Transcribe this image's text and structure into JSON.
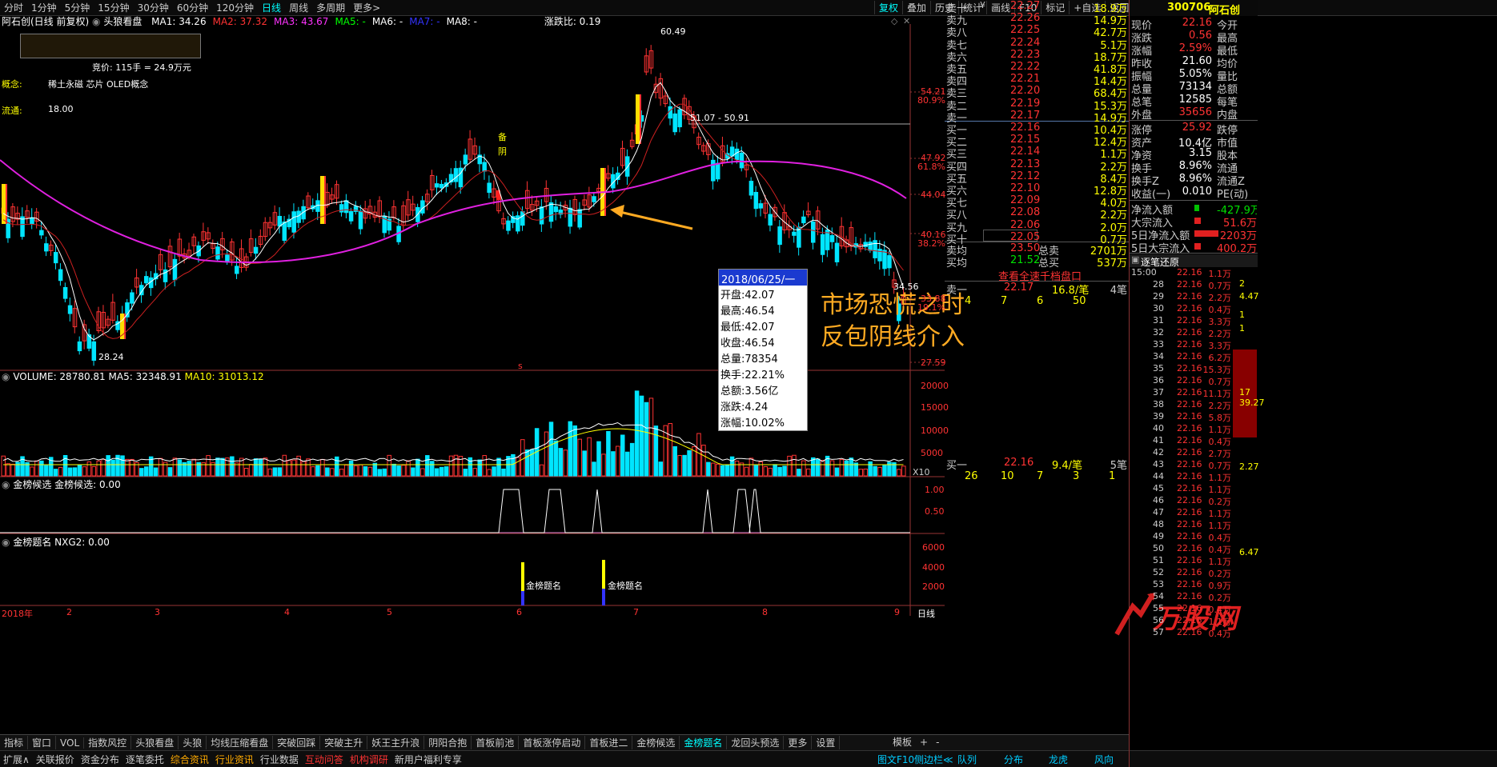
{
  "toolbar": {
    "periods": [
      "分时",
      "1分钟",
      "5分钟",
      "15分钟",
      "30分钟",
      "60分钟",
      "120分钟",
      "日线",
      "周线",
      "多周期",
      "更多>"
    ],
    "active": "日线",
    "tools": [
      "复权",
      "叠加",
      "历史",
      "统计",
      "画线",
      "F10",
      "标记",
      "+自选",
      "返回"
    ]
  },
  "chart": {
    "title": "阿石创(日线 前复权)",
    "indicator": "头狼看盘",
    "ma": [
      {
        "label": "MA1: 34.26",
        "color": "#ffffff"
      },
      {
        "label": "MA2: 37.32",
        "color": "#ff3333"
      },
      {
        "label": "MA3: 43.67",
        "color": "#ff33ff"
      },
      {
        "label": "MA5: -",
        "color": "#00ff00"
      },
      {
        "label": "MA6: -",
        "color": "#ffffff"
      },
      {
        "label": "MA7: -",
        "color": "#3333ff"
      },
      {
        "label": "MA8: -",
        "color": "#ffffff"
      }
    ],
    "ratio": "涨跌比: 0.19",
    "bid": "竞价: 115手 = 24.9万元",
    "concept_label": "概念:",
    "concept": "稀土永磁 芯片 OLED概念",
    "float_label": "流通:",
    "float_value": "18.00",
    "price_axis": [
      {
        "v": "54.21",
        "p": "80.9%"
      },
      {
        "v": "47.92",
        "p": "61.8%"
      },
      {
        "v": "44.04",
        "p": ""
      },
      {
        "v": "40.16",
        "p": "38.2%"
      },
      {
        "v": "33.88",
        "p": "19.1%"
      },
      {
        "v": "27.59",
        "p": ""
      }
    ],
    "high_label": "60.49",
    "low_label": "28.24",
    "range_label": "51.07 - 50.91",
    "last_label": "34.56",
    "mark_text1": "备",
    "mark_text2": "阴",
    "s_marker": "s"
  },
  "tooltip": {
    "date": "2018/06/25/一",
    "lines": [
      "开盘:42.07",
      "最高:46.54",
      "最低:42.07",
      "收盘:46.54",
      "总量:78354",
      "换手:22.21%",
      "总额:3.56亿",
      "涨跌:4.24",
      "涨幅:10.02%"
    ]
  },
  "annotation": {
    "line1": "市场恐慌之时",
    "line2": "反包阴线介入"
  },
  "volume": {
    "title": "VOLUME: 28780.81",
    "ma5": "MA5: 32348.91",
    "ma10": "MA10: 31013.12",
    "axis": [
      "20000",
      "15000",
      "10000",
      "5000"
    ],
    "unit": "X10"
  },
  "jinbang": {
    "title": "金榜候选 金榜候选: 0.00",
    "axis": [
      "1.00",
      "0.50"
    ]
  },
  "timing": {
    "title": "金榜题名 NXG2: 0.00",
    "axis": [
      "6000",
      "4000",
      "2000"
    ],
    "label1": "金榜题名",
    "label2": "金榜题名"
  },
  "months": [
    "2018年",
    "2",
    "3",
    "4",
    "5",
    "6",
    "7",
    "8",
    "9"
  ],
  "period_label": "日线",
  "indicator_tabs": [
    "指标",
    "窗口",
    "VOL",
    "指数风控",
    "头狼看盘",
    "头狼",
    "均线压缩看盘",
    "突破回踩",
    "突破主升",
    "妖王主升浪",
    "阴阳合抱",
    "首板前池",
    "首板涨停启动",
    "首板进二",
    "金榜候选",
    "金榜题名",
    "龙回头预选",
    "更多",
    "设置"
  ],
  "active_tab": "金榜题名",
  "corner_labels": [
    "模板",
    "+",
    "-"
  ],
  "bottom_links": [
    "扩展∧",
    "关联报价",
    "资金分布",
    "逐笔委托",
    "综合资讯",
    "行业资讯",
    "行业数据",
    "互动问答",
    "机构调研",
    "新用户福利专享"
  ],
  "bottom_right": [
    "图文F10",
    "侧边栏≪",
    "队列",
    "分布",
    "龙虎",
    "风向"
  ],
  "stock": {
    "code": "300706",
    "name": "阿石创"
  },
  "asks": [
    {
      "l": "卖十",
      "p": "22.27",
      "v": "18.9万",
      "m": "¥"
    },
    {
      "l": "卖九",
      "p": "22.26",
      "v": "14.9万"
    },
    {
      "l": "卖八",
      "p": "22.25",
      "v": "42.7万"
    },
    {
      "l": "卖七",
      "p": "22.24",
      "v": "5.1万"
    },
    {
      "l": "卖六",
      "p": "22.23",
      "v": "18.7万"
    },
    {
      "l": "卖五",
      "p": "22.22",
      "v": "41.8万"
    },
    {
      "l": "卖四",
      "p": "22.21",
      "v": "14.4万"
    },
    {
      "l": "卖三",
      "p": "22.20",
      "v": "68.4万"
    },
    {
      "l": "卖二",
      "p": "22.19",
      "v": "15.3万"
    },
    {
      "l": "卖一",
      "p": "22.17",
      "v": "14.9万"
    }
  ],
  "bids": [
    {
      "l": "买一",
      "p": "22.16",
      "v": "10.4万"
    },
    {
      "l": "买二",
      "p": "22.15",
      "v": "12.4万"
    },
    {
      "l": "买三",
      "p": "22.14",
      "v": "1.1万"
    },
    {
      "l": "买四",
      "p": "22.13",
      "v": "2.2万"
    },
    {
      "l": "买五",
      "p": "22.12",
      "v": "8.4万"
    },
    {
      "l": "买六",
      "p": "22.10",
      "v": "12.8万"
    },
    {
      "l": "买七",
      "p": "22.09",
      "v": "4.0万"
    },
    {
      "l": "买八",
      "p": "22.08",
      "v": "2.2万"
    },
    {
      "l": "买九",
      "p": "22.06",
      "v": "2.0万"
    },
    {
      "l": "买十",
      "p": "22.05",
      "v": "0.7万"
    }
  ],
  "summary": [
    {
      "l": "卖均",
      "v": "23.50",
      "l2": "总卖",
      "v2": "2701万"
    },
    {
      "l": "买均",
      "v": "21.52",
      "l2": "总买",
      "v2": "537万"
    }
  ],
  "link": "查看全速千档盘口",
  "queue_sell": {
    "l": "卖一",
    "p": "22.17",
    "v": "16.8/笔",
    "n": "4笔",
    "items": [
      "4",
      "7",
      "6",
      "50"
    ]
  },
  "queue_buy": {
    "l": "买一",
    "p": "22.16",
    "v": "9.4/笔",
    "n": "5笔",
    "items": [
      "26",
      "10",
      "7",
      "3",
      "1"
    ]
  },
  "quote": [
    {
      "l": "现价",
      "v": "22.16",
      "c": "red",
      "r": "今开"
    },
    {
      "l": "涨跌",
      "v": "0.56",
      "c": "red",
      "r": "最高"
    },
    {
      "l": "涨幅",
      "v": "2.59%",
      "c": "red",
      "r": "最低"
    },
    {
      "l": "昨收",
      "v": "21.60",
      "c": "white",
      "r": "均价"
    },
    {
      "l": "振幅",
      "v": "5.05%",
      "c": "white",
      "r": "量比"
    },
    {
      "l": "总量",
      "v": "73134",
      "c": "white",
      "r": "总额"
    },
    {
      "l": "总笔",
      "v": "12585",
      "c": "white",
      "r": "每笔"
    },
    {
      "l": "外盘",
      "v": "35656",
      "c": "red",
      "r": "内盘"
    }
  ],
  "quote2": [
    {
      "l": "涨停",
      "v": "25.92",
      "c": "red",
      "r": "跌停"
    },
    {
      "l": "资产",
      "v": "10.4亿",
      "c": "white",
      "r": "市值"
    },
    {
      "l": "净资",
      "v": "3.15",
      "c": "white",
      "r": "股本"
    },
    {
      "l": "换手",
      "v": "8.96%",
      "c": "white",
      "r": "流通"
    },
    {
      "l": "换手Z",
      "v": "8.96%",
      "c": "white",
      "r": "流通Z"
    },
    {
      "l": "收益(一)",
      "v": "0.010",
      "c": "white",
      "r": "PE(动)"
    }
  ],
  "flow": [
    {
      "l": "净流入额",
      "v": "-427.9万",
      "c": "green"
    },
    {
      "l": "大宗流入",
      "v": "51.6万",
      "c": "red"
    },
    {
      "l": "5日净流入额",
      "v": "2203万",
      "c": "red"
    },
    {
      "l": "5日大宗流入",
      "v": "400.2万",
      "c": "red"
    }
  ],
  "tape_title": "逐笔还原",
  "tape": [
    {
      "t": "15:00",
      "p": "22.16",
      "v": "1.1万",
      "c": "red"
    },
    {
      "t": "28",
      "p": "22.16",
      "v": "0.7万",
      "c": "red"
    },
    {
      "t": "29",
      "p": "22.16",
      "v": "2.2万",
      "c": "red"
    },
    {
      "t": "30",
      "p": "22.16",
      "v": "0.4万",
      "c": "red"
    },
    {
      "t": "31",
      "p": "22.16",
      "v": "3.3万",
      "c": "red"
    },
    {
      "t": "32",
      "p": "22.16",
      "v": "2.2万",
      "c": "red"
    },
    {
      "t": "33",
      "p": "22.16",
      "v": "3.3万",
      "c": "red"
    },
    {
      "t": "34",
      "p": "22.16",
      "v": "6.2万",
      "c": "red"
    },
    {
      "t": "35",
      "p": "22.16",
      "v": "15.3万",
      "c": "red"
    },
    {
      "t": "36",
      "p": "22.16",
      "v": "0.7万",
      "c": "red"
    },
    {
      "t": "37",
      "p": "22.16",
      "v": "11.1万",
      "c": "red"
    },
    {
      "t": "38",
      "p": "22.16",
      "v": "2.2万",
      "c": "red"
    },
    {
      "t": "39",
      "p": "22.16",
      "v": "5.8万",
      "c": "red"
    },
    {
      "t": "40",
      "p": "22.16",
      "v": "1.1万",
      "c": "red"
    },
    {
      "t": "41",
      "p": "22.16",
      "v": "0.4万",
      "c": "red"
    },
    {
      "t": "42",
      "p": "22.16",
      "v": "2.7万",
      "c": "red"
    },
    {
      "t": "43",
      "p": "22.16",
      "v": "0.7万",
      "c": "red"
    },
    {
      "t": "44",
      "p": "22.16",
      "v": "1.1万",
      "c": "red"
    },
    {
      "t": "45",
      "p": "22.16",
      "v": "1.1万",
      "c": "red"
    },
    {
      "t": "46",
      "p": "22.16",
      "v": "0.2万",
      "c": "red"
    },
    {
      "t": "47",
      "p": "22.16",
      "v": "1.1万",
      "c": "red"
    },
    {
      "t": "48",
      "p": "22.16",
      "v": "1.1万",
      "c": "red"
    },
    {
      "t": "49",
      "p": "22.16",
      "v": "0.4万",
      "c": "red"
    },
    {
      "t": "50",
      "p": "22.16",
      "v": "0.4万",
      "c": "red"
    },
    {
      "t": "51",
      "p": "22.16",
      "v": "1.1万",
      "c": "red"
    },
    {
      "t": "52",
      "p": "22.16",
      "v": "0.2万",
      "c": "red"
    },
    {
      "t": "53",
      "p": "22.16",
      "v": "0.9万",
      "c": "red"
    },
    {
      "t": "54",
      "p": "22.16",
      "v": "0.2万",
      "c": "red"
    },
    {
      "t": "55",
      "p": "22.16",
      "v": "0.4万",
      "c": "red"
    },
    {
      "t": "56",
      "p": "22.16",
      "v": "1.1万",
      "c": "red"
    },
    {
      "t": "57",
      "p": "22.16",
      "v": "0.4万",
      "c": "red"
    }
  ],
  "tape_side": [
    "2",
    "4.47",
    "1",
    "1",
    "17",
    "39.27",
    "2.27",
    "6.47"
  ],
  "watermark": "万股网"
}
